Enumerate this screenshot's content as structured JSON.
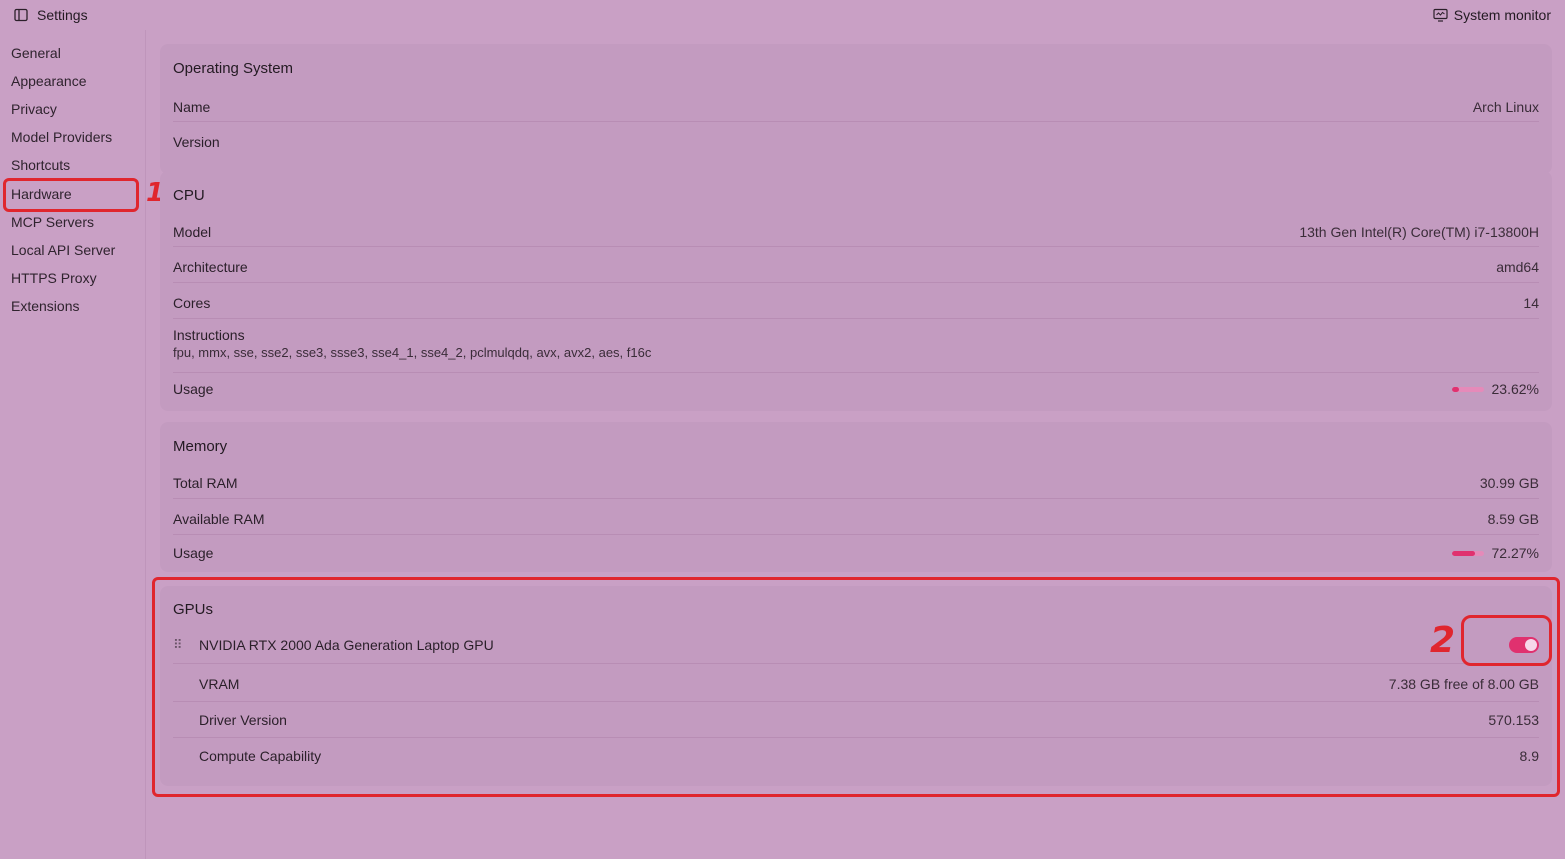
{
  "titlebar": {
    "title": "Settings",
    "right_label": "System monitor"
  },
  "sidebar": {
    "items": [
      {
        "label": "General"
      },
      {
        "label": "Appearance"
      },
      {
        "label": "Privacy"
      },
      {
        "label": "Model Providers"
      },
      {
        "label": "Shortcuts"
      },
      {
        "label": "Hardware"
      },
      {
        "label": "MCP Servers"
      },
      {
        "label": "Local API Server"
      },
      {
        "label": "HTTPS Proxy"
      },
      {
        "label": "Extensions"
      }
    ],
    "active": "Hardware"
  },
  "os": {
    "title": "Operating System",
    "name_label": "Name",
    "name_value": "Arch Linux",
    "version_label": "Version"
  },
  "cpu": {
    "title": "CPU",
    "model_label": "Model",
    "model_value": "13th Gen Intel(R) Core(TM) i7-13800H",
    "arch_label": "Architecture",
    "arch_value": "amd64",
    "cores_label": "Cores",
    "cores_value": "14",
    "instr_label": "Instructions",
    "instr_value": "fpu, mmx, sse, sse2, sse3, ssse3, sse4_1, sse4_2, pclmulqdq, avx, avx2, aes, f16c",
    "usage_label": "Usage",
    "usage_value": "23.62%",
    "usage_fraction": 0.2362
  },
  "memory": {
    "title": "Memory",
    "total_label": "Total RAM",
    "total_value": "30.99 GB",
    "avail_label": "Available RAM",
    "avail_value": "8.59 GB",
    "usage_label": "Usage",
    "usage_value": "72.27%",
    "usage_fraction": 0.7227
  },
  "gpus": {
    "title": "GPUs",
    "name": "NVIDIA RTX 2000 Ada Generation Laptop GPU",
    "enabled": true,
    "vram_label": "VRAM",
    "vram_value": "7.38 GB free of 8.00 GB",
    "driver_label": "Driver Version",
    "driver_value": "570.153",
    "compute_label": "Compute Capability",
    "compute_value": "8.9"
  },
  "annotations": {
    "one": "1",
    "two": "2"
  },
  "colors": {
    "accent": "#e0316f",
    "annotation": "#e0262e",
    "background": "#c9a0c5"
  },
  "icons": {
    "sidebar_toggle": "sidebar-panel-icon",
    "monitor": "monitor-icon",
    "drag": "drag-handle-icon"
  }
}
